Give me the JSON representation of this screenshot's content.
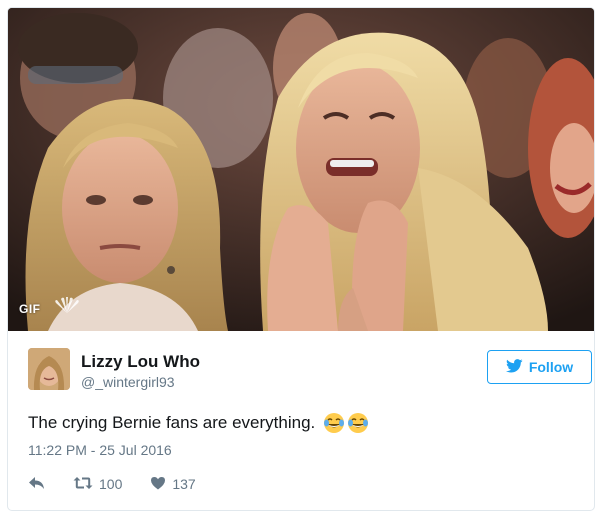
{
  "media": {
    "gif_badge": "GIF",
    "logo": "nbc-peacock-icon"
  },
  "author": {
    "display_name": "Lizzy Lou Who",
    "screen_name": "@_wintergirl93"
  },
  "follow": {
    "label": "Follow",
    "icon": "twitter-bird-icon",
    "color": "#1da1f2"
  },
  "tweet": {
    "text": "The crying Bernie fans are everything.",
    "emoji": [
      "face-with-tears-of-joy",
      "face-with-tears-of-joy"
    ],
    "timestamp": "11:22 PM - 25 Jul 2016"
  },
  "actions": {
    "reply_icon": "reply-icon",
    "retweet_icon": "retweet-icon",
    "retweet_count": "100",
    "like_icon": "heart-icon",
    "like_count": "137"
  },
  "colors": {
    "text": "#14171a",
    "secondary": "#657786",
    "border": "#e1e8ed"
  }
}
